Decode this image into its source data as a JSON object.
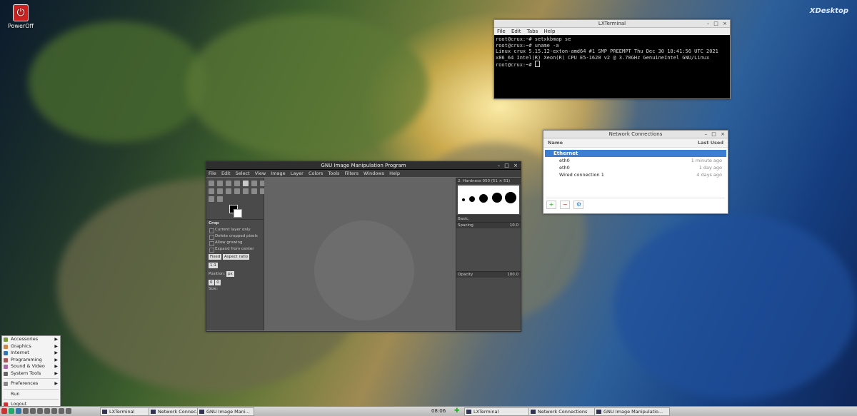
{
  "desktop": {
    "icon_label": "PowerOff",
    "brand": "XDesktop"
  },
  "terminal": {
    "title": "LXTerminal",
    "menu": [
      "File",
      "Edit",
      "Tabs",
      "Help"
    ],
    "lines": [
      "root@crux:~# setxkbmap se",
      "root@crux:~# uname -a",
      "Linux crux 5.15.12-exton-amd64 #1 SMP PREEMPT Thu Dec 30 18:41:56 UTC 2021 x86_64 Intel(R) Xeon(R) CPU E5-1620 v2 @ 3.70GHz GenuineIntel GNU/Linux",
      "root@crux:~# "
    ]
  },
  "network": {
    "title": "Network Connections",
    "col_name": "Name",
    "col_last": "Last Used",
    "group": "Ethernet",
    "rows": [
      {
        "name": "eth0",
        "last": "1 minute ago"
      },
      {
        "name": "eth0",
        "last": "1 day ago"
      },
      {
        "name": "Wired connection 1",
        "last": "4 days ago"
      }
    ],
    "buttons": [
      "+",
      "−",
      "⚙"
    ]
  },
  "gimp": {
    "title": "GNU Image Manipulation Program",
    "menu": [
      "File",
      "Edit",
      "Select",
      "View",
      "Image",
      "Layer",
      "Colors",
      "Tools",
      "Filters",
      "Windows",
      "Help"
    ],
    "tool_options": {
      "heading": "Crop",
      "options": [
        "Current layer only",
        "Delete cropped pixels",
        "Allow growing",
        "Expand from center"
      ],
      "fixed_label": "Fixed",
      "aspect_label": "Aspect ratio",
      "ratio_value": "1:1",
      "position_label": "Position:",
      "size_label": "Size:",
      "unit": "px",
      "zero": "0"
    },
    "dock": {
      "brush_name": "2. Hardness 050 (51 × 51)",
      "basic": "Basic,",
      "spacing": "Spacing",
      "spacing_value": "10.0",
      "opacity": "Opacity",
      "opacity_value": "100.0"
    }
  },
  "start_menu": {
    "items": [
      {
        "label": "Accessories",
        "sub": true,
        "color": "#7a9a3a"
      },
      {
        "label": "Graphics",
        "sub": true,
        "color": "#c84"
      },
      {
        "label": "Internet",
        "sub": true,
        "color": "#37a"
      },
      {
        "label": "Programming",
        "sub": true,
        "color": "#a55"
      },
      {
        "label": "Sound & Video",
        "sub": true,
        "color": "#a6a"
      },
      {
        "label": "System Tools",
        "sub": true,
        "color": "#666"
      }
    ],
    "prefs": "Preferences",
    "run": "Run",
    "logout": "Logout"
  },
  "taskbar": {
    "tasks_left": [
      "LXTerminal",
      "Network Connec...",
      "GNU Image Mani..."
    ],
    "clock": "08:06",
    "tasks_right": [
      "LXTerminal",
      "Network Connections",
      "GNU Image Manipulatio..."
    ]
  }
}
